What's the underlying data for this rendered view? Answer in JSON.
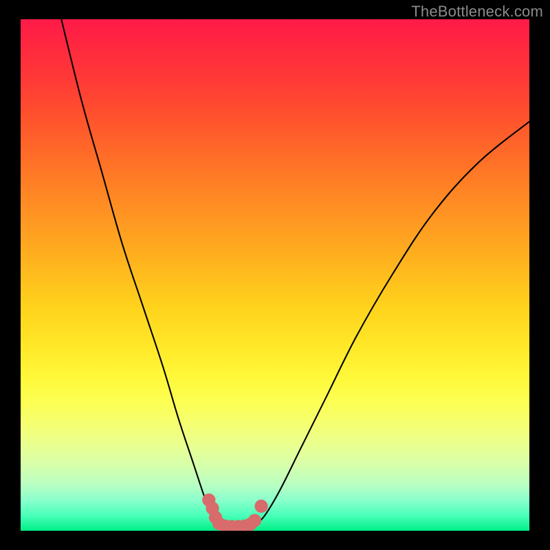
{
  "watermark": "TheBottleneck.com",
  "colors": {
    "frame": "#000000",
    "gradient_top": "#ff1a48",
    "gradient_bottom": "#00ef87",
    "curve": "#000000",
    "marker": "#d86b6b",
    "watermark": "#8b8b8b"
  },
  "chart_data": {
    "type": "line",
    "title": "",
    "xlabel": "",
    "ylabel": "",
    "x_range": [
      0,
      100
    ],
    "y_range": [
      0,
      100
    ],
    "grid": false,
    "legend": "none",
    "notes": "Two black curves descending from top to a near-zero trough around x≈38–47, right branch rises toward upper-right. Salmon rounded markers cluster at the trough. Background is a vertical rainbow gradient (red→green). No axes, ticks, or labels visible; values are pixel-estimated on a 0–100 scale.",
    "series": [
      {
        "name": "left-branch",
        "x": [
          8,
          12,
          16,
          20,
          24,
          28,
          31,
          34,
          36,
          37.5,
          38.5
        ],
        "y": [
          100,
          84,
          70,
          56,
          44,
          32,
          22,
          13,
          7,
          3,
          1
        ]
      },
      {
        "name": "right-branch",
        "x": [
          46,
          48,
          51,
          55,
          60,
          66,
          73,
          81,
          90,
          100
        ],
        "y": [
          1,
          3,
          8,
          16,
          26,
          38,
          50,
          62,
          72,
          80
        ]
      }
    ],
    "markers": {
      "name": "trough-cluster",
      "points": [
        {
          "x": 37.0,
          "y": 6.0
        },
        {
          "x": 37.7,
          "y": 4.4
        },
        {
          "x": 38.3,
          "y": 2.6
        },
        {
          "x": 39.0,
          "y": 1.4
        },
        {
          "x": 40.2,
          "y": 0.9
        },
        {
          "x": 41.5,
          "y": 0.8
        },
        {
          "x": 42.8,
          "y": 0.8
        },
        {
          "x": 44.0,
          "y": 0.9
        },
        {
          "x": 45.2,
          "y": 1.3
        },
        {
          "x": 46.0,
          "y": 2.0
        },
        {
          "x": 47.3,
          "y": 4.8
        }
      ],
      "radius_pct": 1.3
    }
  }
}
